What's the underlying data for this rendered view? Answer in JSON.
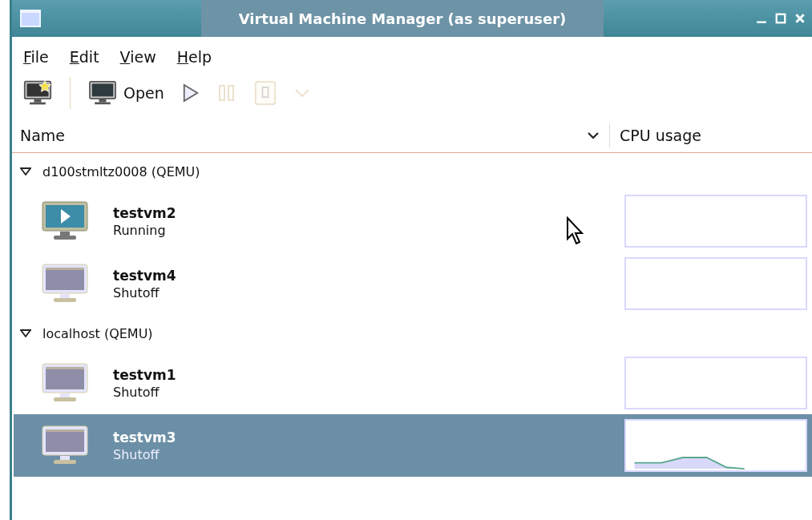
{
  "window": {
    "title": "Virtual Machine Manager (as superuser)"
  },
  "menu": [
    {
      "label": "File"
    },
    {
      "label": "Edit"
    },
    {
      "label": "View"
    },
    {
      "label": "Help"
    }
  ],
  "toolbar": [
    {
      "kind": "new",
      "disabled": false
    },
    {
      "kind": "open",
      "label": "Open",
      "disabled": false
    },
    {
      "kind": "run",
      "disabled": false
    },
    {
      "kind": "pause",
      "disabled": true
    },
    {
      "kind": "shutdown",
      "disabled": true
    },
    {
      "kind": "menu",
      "disabled": true
    }
  ],
  "table": {
    "columns": [
      {
        "label": "Name",
        "sorted": true
      },
      {
        "label": "CPU usage",
        "sorted": false
      }
    ],
    "groups": [
      {
        "label": "d100stmltz0008 (QEMU)",
        "expanded": true,
        "children": [
          {
            "name": "testvm2",
            "status": "Running",
            "running": true,
            "selected": false,
            "cpu_active": false
          },
          {
            "name": "testvm4",
            "status": "Shutoff",
            "running": false,
            "selected": false,
            "cpu_active": false
          }
        ]
      },
      {
        "label": "localhost (QEMU)",
        "expanded": true,
        "children": [
          {
            "name": "testvm1",
            "status": "Shutoff",
            "running": false,
            "selected": false,
            "cpu_active": false
          },
          {
            "name": "testvm3",
            "status": "Shutoff",
            "running": false,
            "selected": true,
            "cpu_active": true
          }
        ]
      }
    ]
  }
}
